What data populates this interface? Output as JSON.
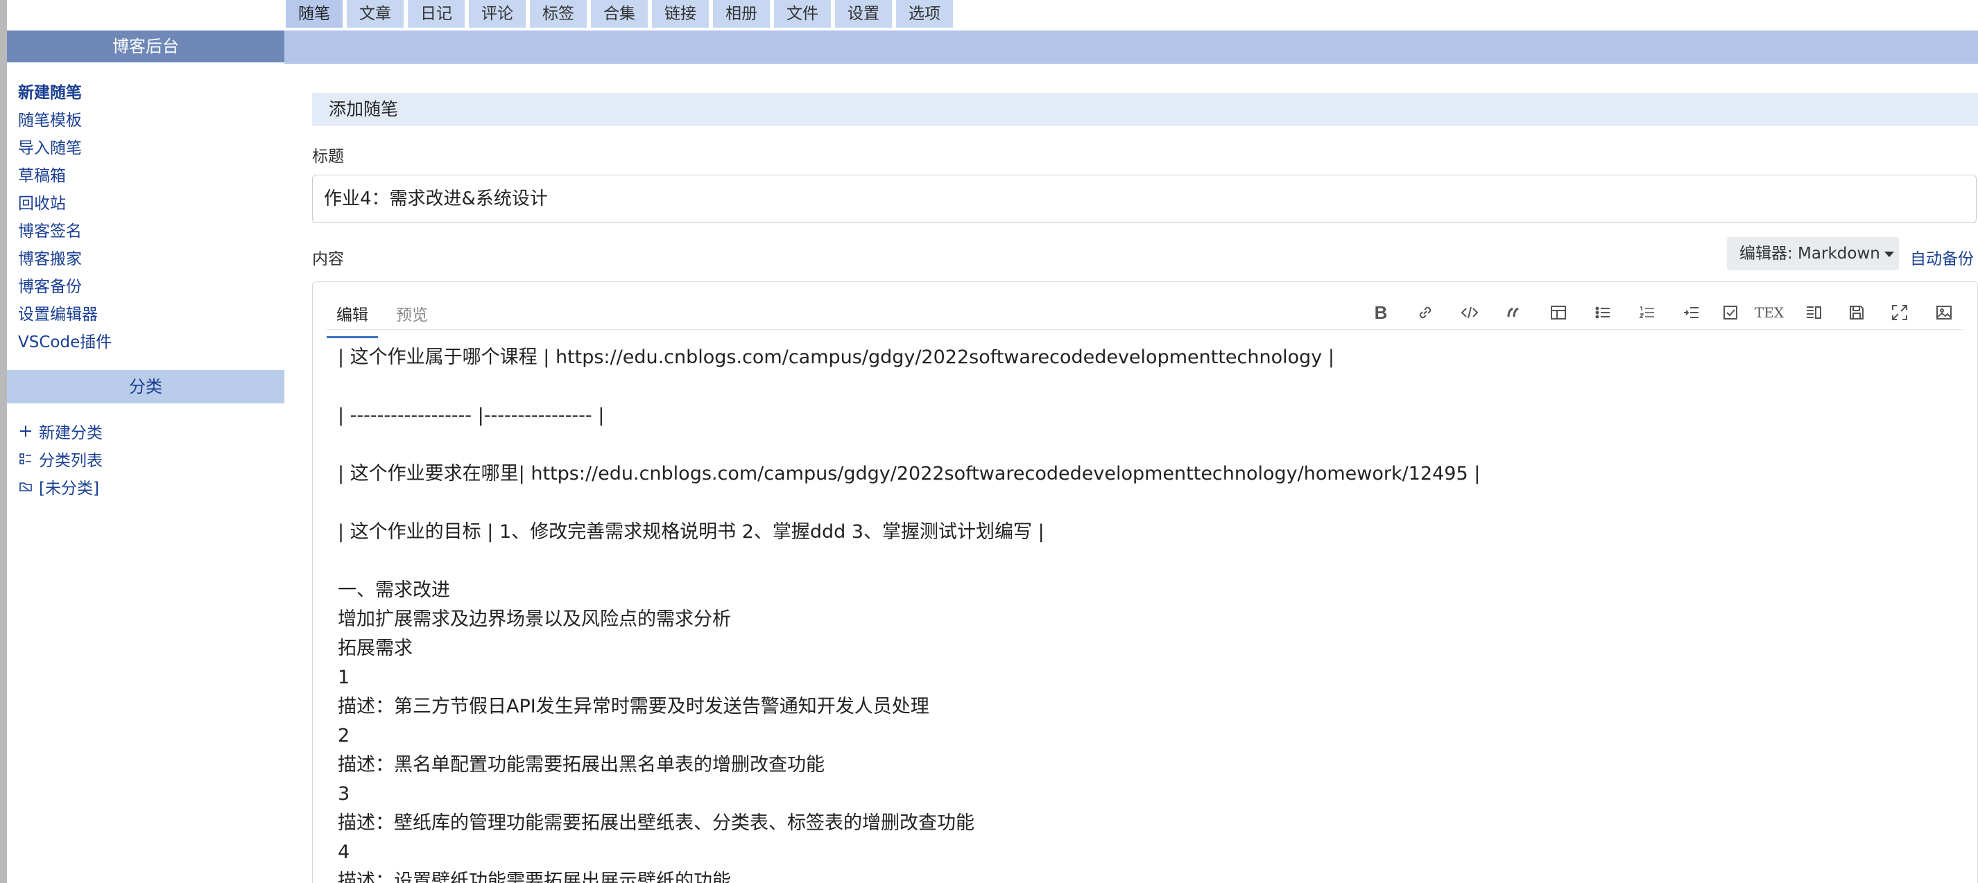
{
  "tabs": [
    "随笔",
    "文章",
    "日记",
    "评论",
    "标签",
    "合集",
    "链接",
    "相册",
    "文件",
    "设置",
    "选项"
  ],
  "sidebar": {
    "title": "博客后台",
    "links": [
      "新建随笔",
      "随笔模板",
      "导入随笔",
      "草稿箱",
      "回收站",
      "博客签名",
      "博客搬家",
      "博客备份",
      "设置编辑器",
      "VSCode插件"
    ],
    "category_title": "分类",
    "category_links": [
      "新建分类",
      "分类列表",
      "[未分类]"
    ]
  },
  "main": {
    "section_title": "添加随笔",
    "title_label": "标题",
    "title_value": "作业4：需求改进&系统设计",
    "content_label": "内容",
    "editor_select": "编辑器: Markdown",
    "autobackup": "自动备份"
  },
  "editor": {
    "tabs": [
      "编辑",
      "预览"
    ],
    "lines": [
      "| 这个作业属于哪个课程 | https://edu.cnblogs.com/campus/gdgy/2022softwarecodedevelopmenttechnology |",
      "",
      "| ------------------ |---------------- |",
      "",
      "| 这个作业要求在哪里| https://edu.cnblogs.com/campus/gdgy/2022softwarecodedevelopmenttechnology/homework/12495 |",
      "",
      "| 这个作业的目标 | 1、修改完善需求规格说明书 2、掌握ddd 3、掌握测试计划编写 |",
      "",
      "一、需求改进",
      "增加扩展需求及边界场景以及风险点的需求分析",
      "拓展需求",
      "1",
      "描述：第三方节假日API发生异常时需要及时发送告警通知开发人员处理",
      "2",
      "描述：黑名单配置功能需要拓展出黑名单表的增删改查功能",
      "3",
      "描述：壁纸库的管理功能需要拓展出壁纸表、分类表、标签表的增删改查功能",
      "4",
      "描述：设置壁纸功能需要拓展出展示壁纸的功能"
    ],
    "toolbar_icons": [
      "bold-icon",
      "link-icon",
      "code-icon",
      "quote-icon",
      "table-icon",
      "bullet-list-icon",
      "ordered-list-icon",
      "indent-icon",
      "checkbox-icon",
      "tex-icon",
      "side-by-side-icon",
      "save-icon",
      "fullscreen-icon",
      "image-icon"
    ],
    "tex_label": "TEX",
    "bold_label": "B"
  }
}
